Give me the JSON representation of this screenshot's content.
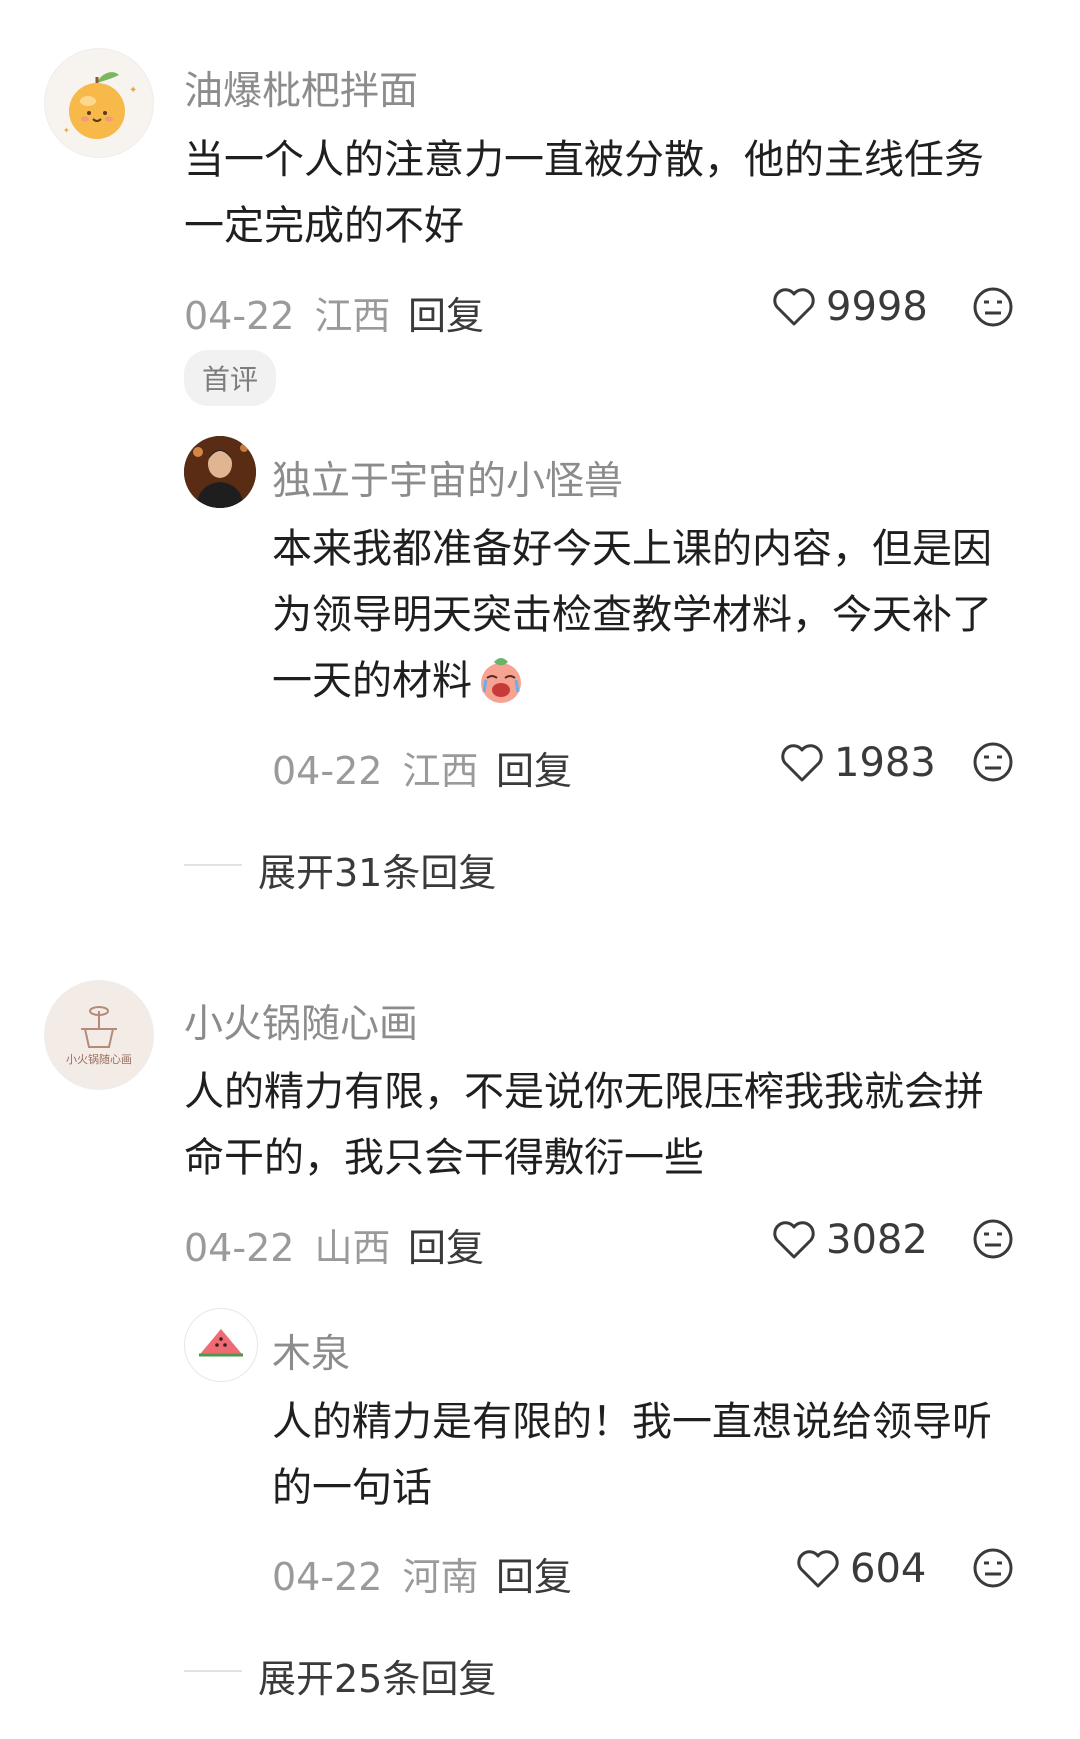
{
  "comments": [
    {
      "author": "油爆枇杷拌面",
      "text_line1": "当一个人的注意力一直被分散，他的主线任务",
      "text_line2": "一定完成的不好",
      "date": "04-22",
      "location": "江西",
      "reply_label": "回复",
      "likes": "9998",
      "badge": "首评",
      "reply": {
        "author": "独立于宇宙的小怪兽",
        "text_line1": "本来我都准备好今天上课的内容，但是因",
        "text_line2": "为领导明天突击检查教学材料，今天补了",
        "text_line3": "一天的材料",
        "emoji_icon": "crying-face-sticker",
        "date": "04-22",
        "location": "江西",
        "reply_label": "回复",
        "likes": "1983"
      },
      "expand_label": "展开31条回复"
    },
    {
      "author": "小火锅随心画",
      "avatar_caption": "小火锅随心画",
      "text_line1": "人的精力有限，不是说你无限压榨我我就会拼",
      "text_line2": "命干的，我只会干得敷衍一些",
      "date": "04-22",
      "location": "山西",
      "reply_label": "回复",
      "likes": "3082",
      "reply": {
        "author": "木泉",
        "text_line1": "人的精力是有限的！我一直想说给领导听",
        "text_line2": "的一句话",
        "date": "04-22",
        "location": "河南",
        "reply_label": "回复",
        "likes": "604"
      },
      "expand_label": "展开25条回复"
    }
  ],
  "icons": {
    "like": "heart-outline-icon",
    "dislike": "meh-face-icon"
  },
  "colors": {
    "name": "#8c8c8c",
    "meta": "#9a9a9a",
    "text": "#1f1f1f"
  }
}
